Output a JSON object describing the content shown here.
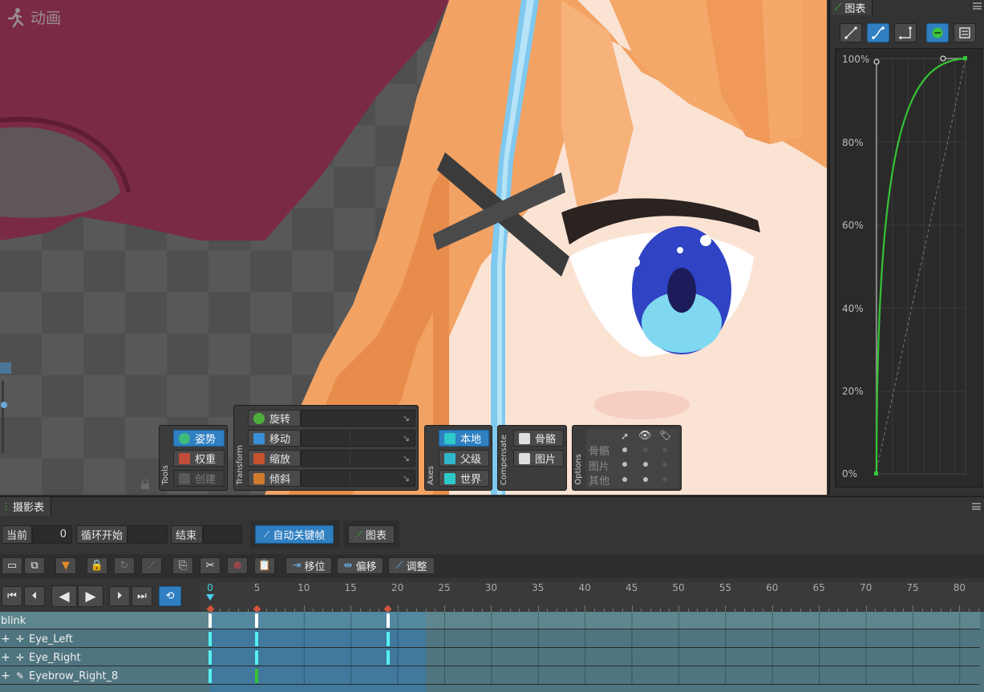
{
  "viewport": {
    "title": "动画",
    "tools_panel": {
      "label": "Tools",
      "buttons": [
        {
          "label": "姿势",
          "icon": "pose-icon",
          "state": "active"
        },
        {
          "label": "权重",
          "icon": "weights-icon",
          "state": "normal"
        },
        {
          "label": "创建",
          "icon": "create-icon",
          "state": "disabled"
        }
      ]
    },
    "transform_panel": {
      "label": "Transform",
      "buttons": [
        {
          "label": "旋转",
          "icon": "rotate-icon"
        },
        {
          "label": "移动",
          "icon": "translate-icon"
        },
        {
          "label": "缩放",
          "icon": "scale-icon"
        },
        {
          "label": "倾斜",
          "icon": "shear-icon"
        }
      ]
    },
    "axes_panel": {
      "label": "Axes",
      "buttons": [
        {
          "label": "本地",
          "icon": "local-axis-icon",
          "state": "active"
        },
        {
          "label": "父级",
          "icon": "parent-axis-icon",
          "state": "normal"
        },
        {
          "label": "世界",
          "icon": "world-axis-icon",
          "state": "normal"
        }
      ]
    },
    "compensate_panel": {
      "label": "Compensate",
      "buttons": [
        {
          "label": "骨骼",
          "icon": "bone-compensate-icon"
        },
        {
          "label": "图片",
          "icon": "image-compensate-icon"
        }
      ]
    },
    "options_panel": {
      "label": "Options",
      "rows": [
        {
          "label": "骨骼",
          "select": true,
          "visible": false,
          "names": false
        },
        {
          "label": "图片",
          "select": true,
          "visible": true,
          "names": false
        },
        {
          "label": "其他",
          "select": true,
          "visible": true,
          "names": false
        }
      ]
    }
  },
  "graph": {
    "tab_label": "图表",
    "y_labels": [
      "100%",
      "80%",
      "60%",
      "40%",
      "20%",
      "0%"
    ],
    "curve_color": "#35c435",
    "mode_buttons": [
      {
        "icon": "linear-curve-icon",
        "active": false
      },
      {
        "icon": "bezier-curve-icon",
        "active": true
      },
      {
        "icon": "stepped-curve-icon",
        "active": false
      },
      {
        "icon": "preset-curve-icon",
        "active": true
      },
      {
        "icon": "custom-curve-icon",
        "active": false
      }
    ]
  },
  "dopesheet": {
    "tab_label": "摄影表",
    "current_label": "当前",
    "current_value": "0",
    "loop_start_label": "循环开始",
    "loop_start_value": "",
    "end_label": "结束",
    "end_value": "",
    "autokey_label": "自动关键帧",
    "graph_button_label": "图表",
    "offset_buttons": [
      "移位",
      "偏移",
      "调整"
    ],
    "ruler_labels": [
      "0",
      "5",
      "10",
      "15",
      "20",
      "25",
      "30",
      "35",
      "40",
      "45",
      "50",
      "55",
      "60",
      "65",
      "70",
      "75",
      "80"
    ],
    "animation_name": "blink",
    "tracks": [
      {
        "name": "Eye_Left",
        "icon": "bone-icon",
        "keys": [
          0,
          5,
          19
        ]
      },
      {
        "name": "Eye_Right",
        "icon": "bone-icon",
        "keys": [
          0,
          5,
          19
        ]
      },
      {
        "name": "Eyebrow_Right_8",
        "icon": "brush-icon",
        "keys": [
          0,
          5
        ]
      }
    ],
    "summary_keys": [
      0,
      5,
      19
    ],
    "selection_end_frame": 23,
    "accent_color": "#2f7fc1"
  }
}
